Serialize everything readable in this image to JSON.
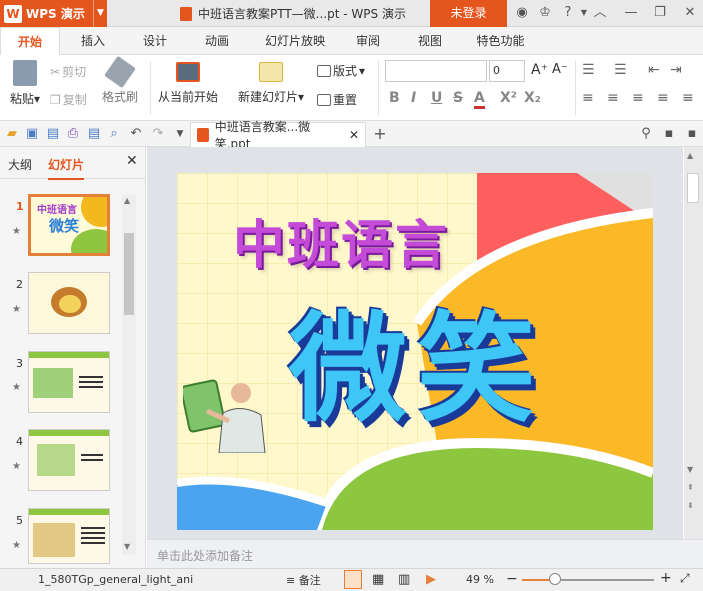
{
  "app": {
    "name": "WPS 演示",
    "title": "中班语言教案PTT—微...pt - WPS 演示",
    "login": "未登录"
  },
  "tabs": [
    "开始",
    "插入",
    "设计",
    "动画",
    "幻灯片放映",
    "审阅",
    "视图",
    "特色功能"
  ],
  "ribbon": {
    "paste": "粘贴",
    "cut": "剪切",
    "copy": "复制",
    "format_painter": "格式刷",
    "from_current": "从当前开始",
    "new_slide": "新建幻灯片",
    "layout": "版式",
    "reset": "重置",
    "font_size": "0"
  },
  "doc_tab": "中班语言教案...微笑.ppt",
  "left_pane": {
    "outline_tab": "大纲",
    "slides_tab": "幻灯片",
    "slide_numbers": [
      "1",
      "2",
      "3",
      "4",
      "5"
    ]
  },
  "slide": {
    "title1": "中班语言",
    "title2": "微笑",
    "thumb_title": "中班语言",
    "thumb_sub": "微笑"
  },
  "notes_placeholder": "单击此处添加备注",
  "status": {
    "template": "1_580TGp_general_light_ani",
    "notes": "备注",
    "zoom": "49 %",
    "zoom_fraction": 0.25
  }
}
